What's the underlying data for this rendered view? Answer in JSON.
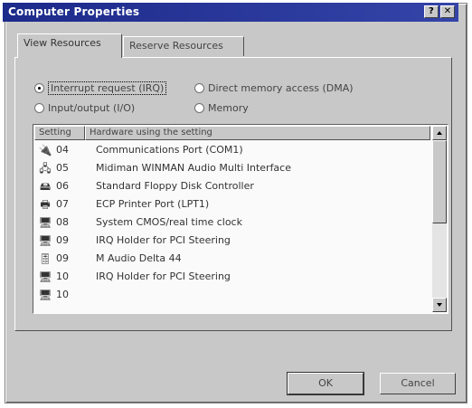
{
  "window": {
    "title": "Computer Properties",
    "help_glyph": "?",
    "close_glyph": "✕"
  },
  "tabs": [
    {
      "label": "View Resources",
      "active": true
    },
    {
      "label": "Reserve Resources",
      "active": false
    }
  ],
  "radios": {
    "irq": {
      "label": "Interrupt request (IRQ)",
      "checked": true
    },
    "dma": {
      "label": "Direct memory access (DMA)",
      "checked": false
    },
    "io": {
      "label": "Input/output (I/O)",
      "checked": false
    },
    "memory": {
      "label": "Memory",
      "checked": false
    }
  },
  "list": {
    "columns": [
      "Setting",
      "Hardware using the setting"
    ],
    "rows": [
      {
        "icon": "serial-port-icon",
        "glyph": "🔌",
        "setting": "04",
        "device": "Communications Port (COM1)"
      },
      {
        "icon": "network-adapter-icon",
        "glyph": "🖧",
        "setting": "05",
        "device": "Midiman WINMAN Audio Multi Interface"
      },
      {
        "icon": "floppy-controller-icon",
        "glyph": "🖴",
        "setting": "06",
        "device": "Standard Floppy Disk Controller"
      },
      {
        "icon": "printer-port-icon",
        "glyph": "🖶",
        "setting": "07",
        "device": "ECP Printer Port (LPT1)"
      },
      {
        "icon": "system-device-icon",
        "glyph": "🖥",
        "setting": "08",
        "device": "System CMOS/real time clock"
      },
      {
        "icon": "system-device-icon",
        "glyph": "🖥",
        "setting": "09",
        "device": "IRQ Holder for PCI Steering"
      },
      {
        "icon": "audio-device-icon",
        "glyph": "🎚",
        "setting": "09",
        "device": "M Audio Delta 44"
      },
      {
        "icon": "system-device-icon",
        "glyph": "🖥",
        "setting": "10",
        "device": "IRQ Holder for PCI Steering"
      },
      {
        "icon": "system-device-icon",
        "glyph": "🖥",
        "setting": "10",
        "device": ""
      }
    ]
  },
  "buttons": {
    "ok": "OK",
    "cancel": "Cancel"
  }
}
